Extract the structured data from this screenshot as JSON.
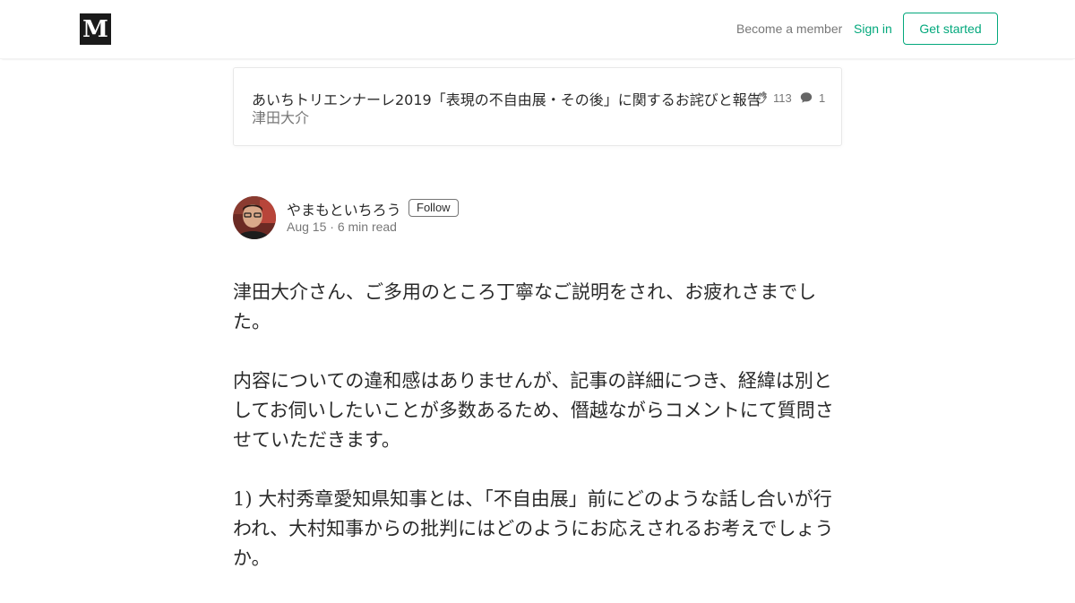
{
  "header": {
    "logo_letter": "M",
    "become_member": "Become a member",
    "sign_in": "Sign in",
    "get_started": "Get started",
    "accent_color": "#03a87c"
  },
  "parent_story": {
    "title": "あいちトリエンナーレ2019「表現の不自由展・その後」に関するお詫びと報告",
    "author": "津田大介",
    "claps": "113",
    "responses": "1",
    "clap_icon": "clap-icon",
    "response_icon": "speech-bubble-icon"
  },
  "response": {
    "author_name": "やまもといちろう",
    "follow_label": "Follow",
    "meta": "Aug 15 · 6 min read",
    "paragraphs": [
      "津田大介さん、ご多用のところ丁寧なご説明をされ、お疲れさまでした。",
      "内容についての違和感はありませんが、記事の詳細につき、経緯は別としてお伺いしたいことが多数あるため、僭越ながらコメントにて質問させていただきます。",
      "1) 大村秀章愛知県知事とは、「不自由展」前にどのような話し合いが行われ、大村知事からの批判にはどのようにお応えされるお考えでしょうか。"
    ]
  }
}
